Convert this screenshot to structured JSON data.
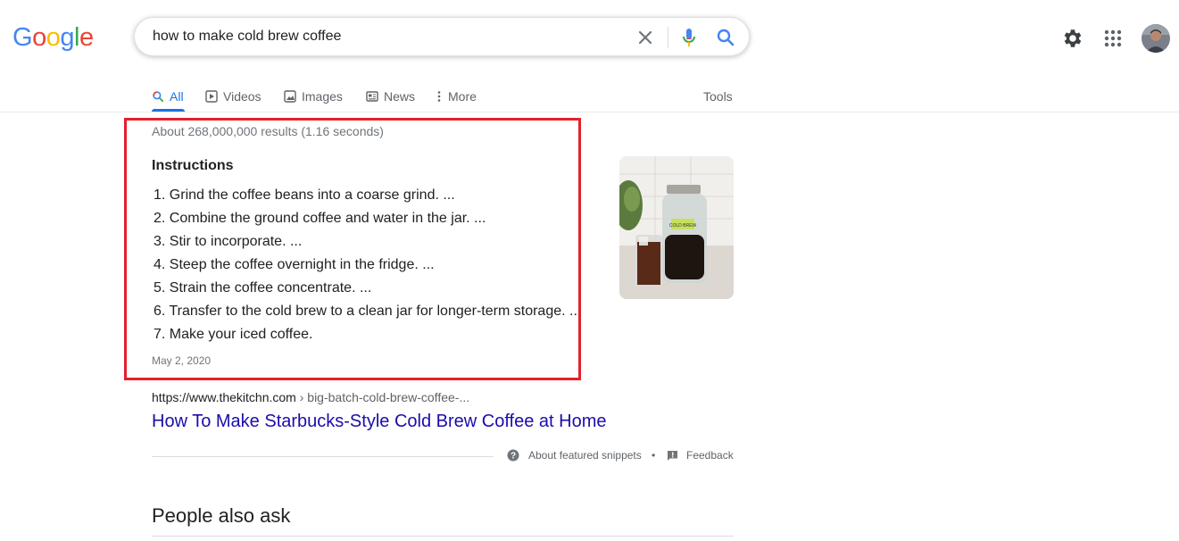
{
  "header": {
    "logo_letters": [
      "G",
      "o",
      "o",
      "g",
      "l",
      "e"
    ],
    "search": {
      "value": "how to make cold brew coffee"
    }
  },
  "tabs": {
    "all": "All",
    "videos": "Videos",
    "images": "Images",
    "news": "News",
    "more": "More",
    "tools": "Tools"
  },
  "results": {
    "stats": "About 268,000,000 results (1.16 seconds)",
    "featured_snippet": {
      "title": "Instructions",
      "steps": [
        "1. Grind the coffee beans into a coarse grind. ...",
        "2. Combine the ground coffee and water in the jar. ...",
        "3. Stir to incorporate. ...",
        "4. Steep the coffee overnight in the fridge. ...",
        "5. Strain the coffee concentrate. ...",
        "6. Transfer to the cold brew to a clean jar for longer-term storage. ...",
        "7. Make your iced coffee."
      ],
      "date": "May 2, 2020",
      "image_label": "COLD BREW"
    },
    "source_url": "https://www.thekitchn.com",
    "source_crumb": "› big-batch-cold-brew-coffee-...",
    "source_title": "How To Make Starbucks-Style Cold Brew Coffee at Home",
    "about_snippets": "About featured snippets",
    "separator": "•",
    "feedback": "Feedback",
    "people_also_ask": "People also ask"
  },
  "colors": {
    "accent_blue": "#1a73e8",
    "link": "#1a0dab",
    "highlight_border": "#e5202b"
  },
  "icons": {
    "clear": "close-icon",
    "mic": "microphone-icon",
    "search": "search-icon",
    "settings": "gear-icon",
    "apps": "apps-grid-icon"
  }
}
